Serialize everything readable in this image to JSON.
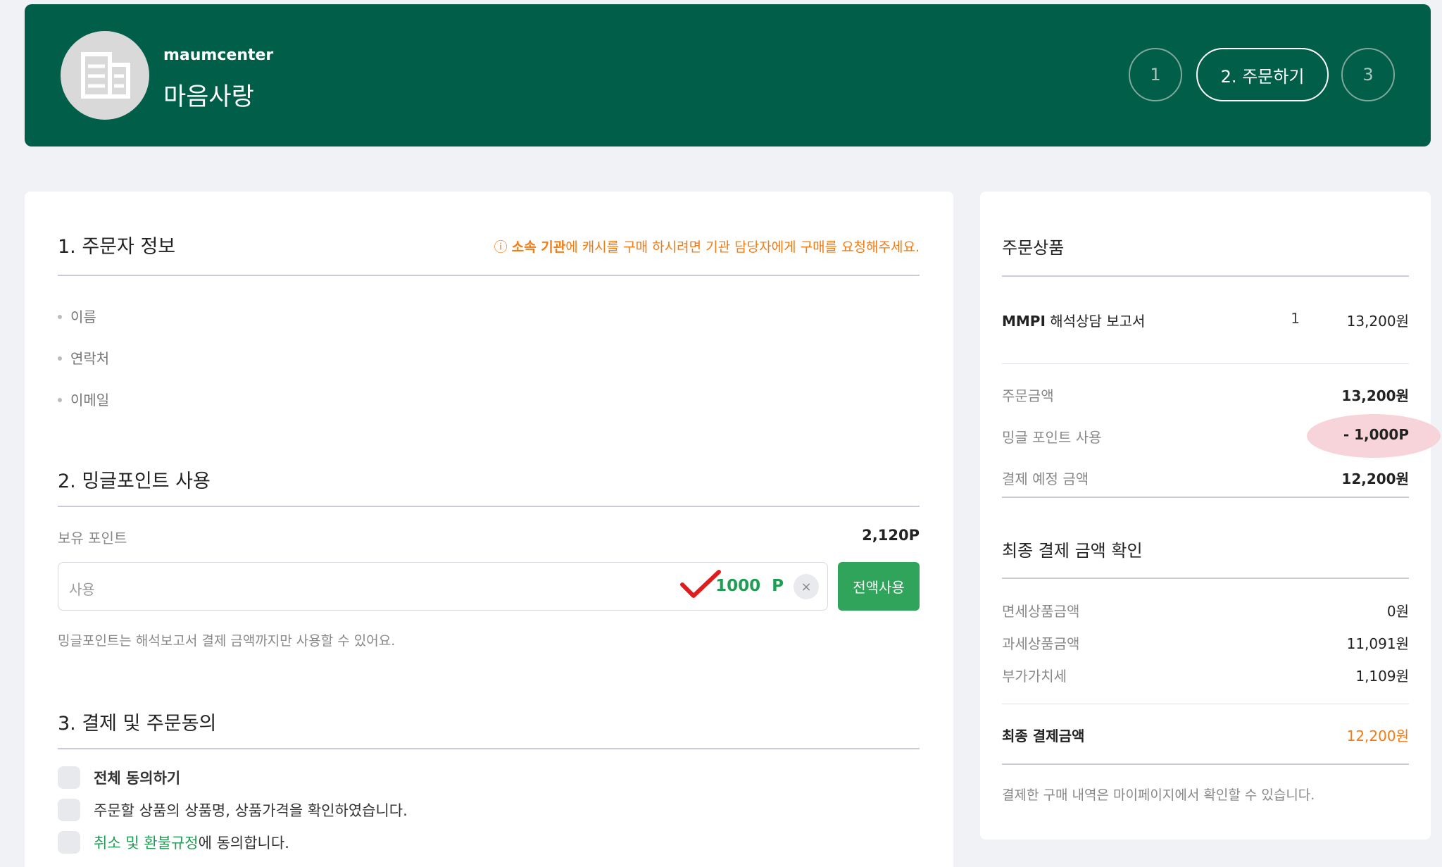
{
  "header": {
    "org_id": "maumcenter",
    "org_name": "마음사랑",
    "steps": [
      "1",
      "2. 주문하기",
      "3"
    ]
  },
  "section1": {
    "title": "1. 주문자 정보",
    "notice_prefix": "ⓘ ",
    "notice_bold": "소속 기관",
    "notice_rest": "에 캐시를 구매 하시려면 기관 담당자에게 구매를 요청해주세요.",
    "fields": [
      "이름",
      "연락처",
      "이메일"
    ]
  },
  "section2": {
    "title": "2. 밍글포인트 사용",
    "held_label": "보유 포인트",
    "held_value": "2,120P",
    "input_placeholder": "사용",
    "input_value": "1000",
    "input_unit": "P",
    "clear_symbol": "×",
    "use_all_label": "전액사용",
    "note": "밍글포인트는 해석보고서 결제 금액까지만 사용할 수 있어요."
  },
  "section3": {
    "title": "3. 결제 및 주문동의",
    "agree_all": "전체 동의하기",
    "agree_product": "주문할 상품의 상품명, 상품가격을 확인하였습니다.",
    "agree_refund_link": "취소 및 환불규정",
    "agree_refund_rest": "에 동의합니다."
  },
  "order": {
    "title": "주문상품",
    "product_bold": "MMPI",
    "product_rest": " 해석상담 보고서",
    "product_qty": "1",
    "product_price": "13,200원",
    "order_amount_label": "주문금액",
    "order_amount_value": "13,200원",
    "points_label": "밍글 포인트 사용",
    "points_value": "- 1,000P",
    "expected_label": "결제 예정 금액",
    "expected_value": "12,200원"
  },
  "final": {
    "title": "최종 결제 금액 확인",
    "taxfree_label": "면세상품금액",
    "taxfree_value": "0원",
    "taxable_label": "과세상품금액",
    "taxable_value": "11,091원",
    "vat_label": "부가가치세",
    "vat_value": "1,109원",
    "total_label": "최종 결제금액",
    "total_value": "12,200원",
    "footnote": "결제한 구매 내역은 마이페이지에서 확인할 수 있습니다."
  },
  "colors": {
    "brand": "#005e49",
    "accent_green": "#30a45a",
    "notice_orange": "#f47b12",
    "highlight_pink": "#f7d4d9",
    "check_red": "#e01d1d"
  }
}
